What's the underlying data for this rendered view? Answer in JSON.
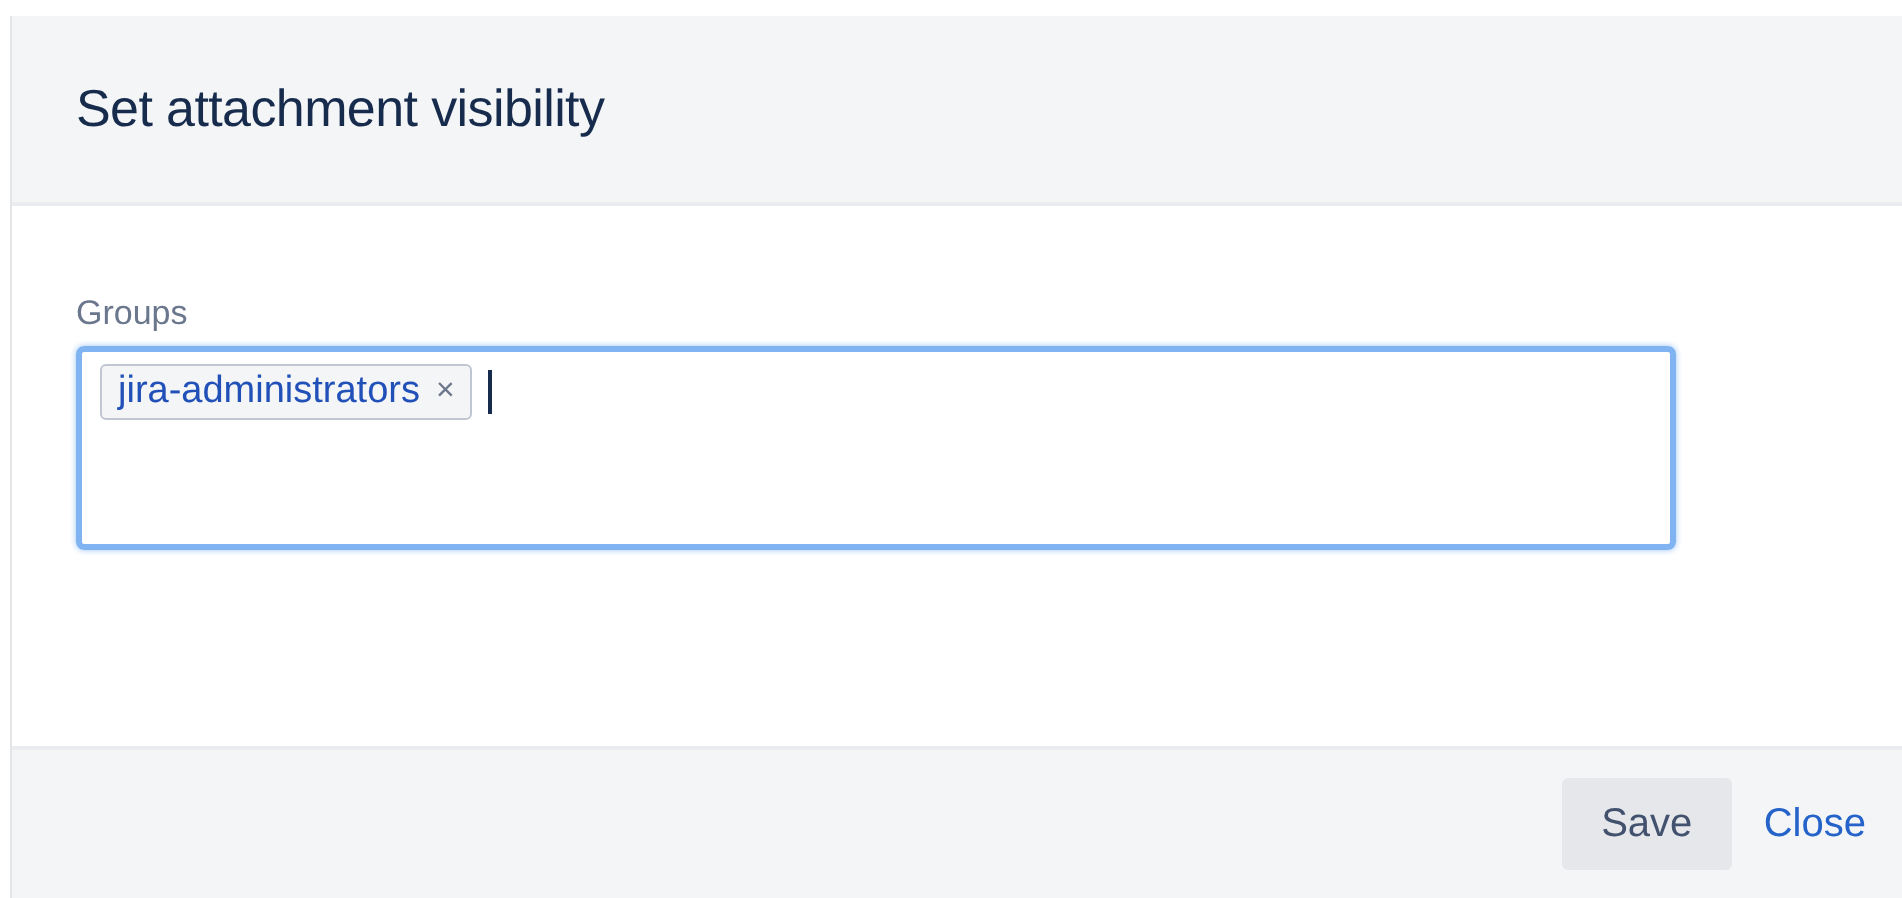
{
  "dialog": {
    "title": "Set attachment visibility",
    "groups_field": {
      "label": "Groups",
      "tags": [
        {
          "label": "jira-administrators",
          "remove": "×"
        }
      ],
      "focused": true
    },
    "buttons": [
      {
        "label": "Save",
        "kind": "button"
      },
      {
        "label": "Close",
        "kind": "link"
      }
    ]
  }
}
